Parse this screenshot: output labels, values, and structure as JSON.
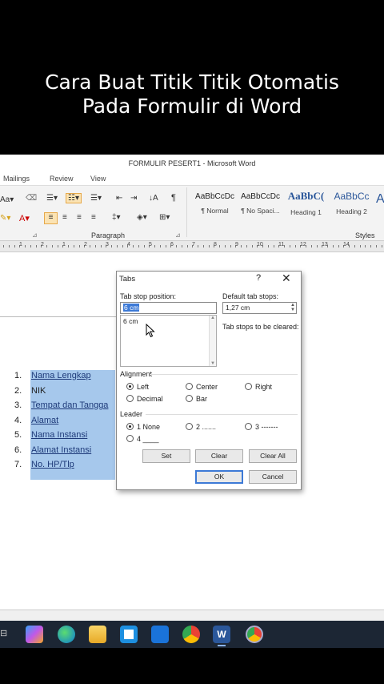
{
  "caption": {
    "line1": "Cara Buat Titik Titik Otomatis",
    "line2": "Pada Formulir di Word"
  },
  "window_title": "FORMULIR PESERT1  -  Microsoft Word",
  "menubar": {
    "items": [
      "Mailings",
      "Review",
      "View"
    ]
  },
  "ribbon": {
    "group_paragraph": "Paragraph",
    "group_styles": "Styles",
    "font_size_label": "Aa",
    "styles": [
      {
        "preview": "AaBbCcDc",
        "label": "¶ Normal"
      },
      {
        "preview": "AaBbCcDc",
        "label": "¶ No Spaci..."
      },
      {
        "preview": "AaBbC(",
        "label": "Heading 1"
      },
      {
        "preview": "AaBbCc",
        "label": "Heading 2"
      }
    ]
  },
  "ruler_numbers": [
    "1",
    "2",
    "1",
    "2",
    "3",
    "4",
    "5",
    "6",
    "7",
    "8",
    "9",
    "10",
    "11",
    "12",
    "13",
    "14"
  ],
  "document": {
    "list": [
      {
        "num": "1.",
        "text": "Nama Lengkap",
        "underline": true
      },
      {
        "num": "2.",
        "text": "NIK",
        "underline": false
      },
      {
        "num": "3.",
        "text": "Tempat dan Tangga",
        "underline": true
      },
      {
        "num": "4.",
        "text": "Alamat",
        "underline": true
      },
      {
        "num": "5.",
        "text": "Nama Instansi",
        "underline": true
      },
      {
        "num": "6.",
        "text": "Alamat Instansi",
        "underline": true
      },
      {
        "num": "7.",
        "text": "No. HP/Tlp",
        "underline": true
      }
    ]
  },
  "dialog": {
    "title": "Tabs",
    "help": "?",
    "close": "✕",
    "tab_stop_position_label": "Tab stop position:",
    "tab_stop_position_value": "6 cm",
    "tab_stops_list": [
      "6 cm"
    ],
    "default_tab_stops_label": "Default tab stops:",
    "default_tab_stops_value": "1,27 cm",
    "tab_stops_cleared_label": "Tab stops to be cleared:",
    "alignment_label": "Alignment",
    "alignment_options": [
      {
        "label": "Left",
        "selected": true
      },
      {
        "label": "Center",
        "selected": false
      },
      {
        "label": "Right",
        "selected": false
      },
      {
        "label": "Decimal",
        "selected": false
      },
      {
        "label": "Bar",
        "selected": false
      }
    ],
    "leader_label": "Leader",
    "leader_options": [
      {
        "label": "1 None",
        "selected": true
      },
      {
        "label": "2 .......",
        "selected": false
      },
      {
        "label": "3 -------",
        "selected": false
      },
      {
        "label": "4 ____",
        "selected": false
      }
    ],
    "buttons": {
      "set": "Set",
      "clear": "Clear",
      "clear_all": "Clear All",
      "ok": "OK",
      "cancel": "Cancel"
    }
  },
  "taskbar": {
    "icons": [
      "copilot-icon",
      "edge-icon",
      "file-explorer-icon",
      "store-icon",
      "mail-icon",
      "chrome-icon",
      "word-icon",
      "chrome-profile-icon"
    ]
  },
  "colors": {
    "selection": "#a6c8ec",
    "accent": "#3d7ad6",
    "word_blue": "#2b579a"
  }
}
